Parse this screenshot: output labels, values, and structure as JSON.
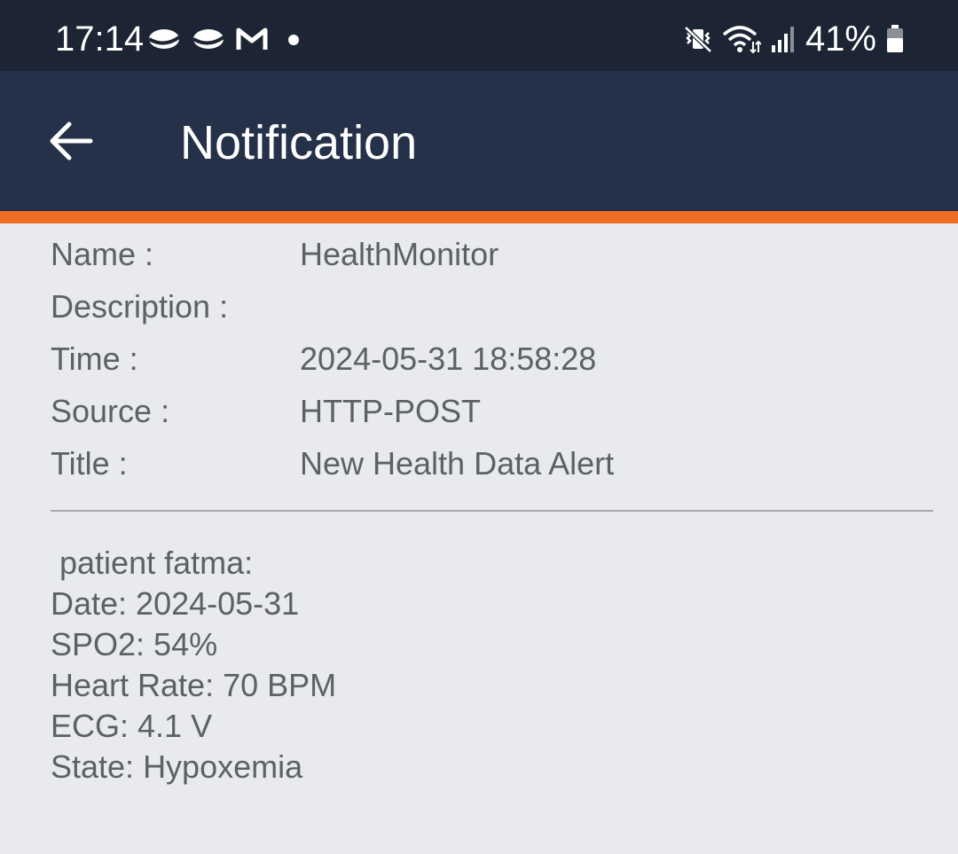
{
  "status_bar": {
    "time": "17:14",
    "battery": "41%",
    "left_icons": [
      "planet-icon",
      "planet-icon",
      "gmail-icon",
      "dot-icon"
    ],
    "right_icons": [
      "vibrate-icon",
      "wifi-icon",
      "signal-icon",
      "battery-icon"
    ]
  },
  "app_bar": {
    "title": "Notification",
    "back_icon": "arrow-left-icon",
    "background": "#253049",
    "accent_color": "#ef6c23"
  },
  "details": {
    "name_label": "Name :",
    "name_value": "HealthMonitor",
    "description_label": "Description :",
    "description_value": "",
    "time_label": "Time :",
    "time_value": "2024-05-31 18:58:28",
    "source_label": "Source :",
    "source_value": "HTTP-POST",
    "title_label": "Title :",
    "title_value": "New Health Data Alert"
  },
  "message": {
    "lines": [
      " patient fatma:",
      "Date: 2024-05-31",
      "SPO2: 54%",
      "Heart Rate: 70 BPM",
      "ECG: 4.1 V",
      "State: Hypoxemia"
    ]
  }
}
